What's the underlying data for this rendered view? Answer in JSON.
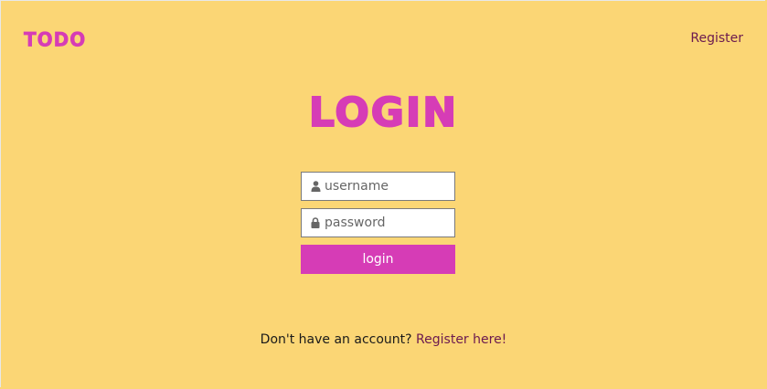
{
  "header": {
    "brand": "TODO",
    "register_link": "Register"
  },
  "main": {
    "title": "LOGIN",
    "username": {
      "placeholder": "username",
      "value": "",
      "icon": "user-icon"
    },
    "password": {
      "placeholder": "password",
      "value": "",
      "icon": "lock-icon"
    },
    "login_label": "login"
  },
  "footer": {
    "prompt": "Don't have an account?",
    "register_link": "Register here!"
  },
  "colors": {
    "background": "#fbd675",
    "accent": "#d63cb6",
    "link": "#6b1a4f"
  }
}
